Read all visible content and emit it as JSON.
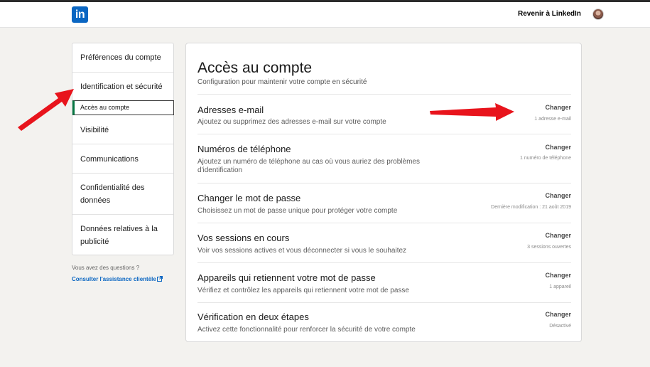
{
  "header": {
    "logo": "in",
    "back_link": "Revenir à LinkedIn"
  },
  "sidebar": {
    "items": [
      {
        "label": "Préférences du compte"
      },
      {
        "label": "Identification et sécurité"
      },
      {
        "label": "Accès au compte"
      },
      {
        "label": "Visibilité"
      },
      {
        "label": "Communications"
      },
      {
        "label": "Confidentialité des données"
      },
      {
        "label": "Données relatives à la publicité"
      }
    ],
    "help_question": "Vous avez des questions ?",
    "help_link": "Consulter l'assistance clientèle"
  },
  "main": {
    "title": "Accès au compte",
    "subtitle": "Configuration pour maintenir votre compte en sécurité",
    "rows": [
      {
        "title": "Adresses e-mail",
        "desc": "Ajoutez ou supprimez des adresses e-mail sur votre compte",
        "action": "Changer",
        "status": "1 adresse e-mail"
      },
      {
        "title": "Numéros de téléphone",
        "desc": "Ajoutez un numéro de téléphone au cas où vous auriez des problèmes d'identification",
        "action": "Changer",
        "status": "1 numéro de téléphone"
      },
      {
        "title": "Changer le mot de passe",
        "desc": "Choisissez un mot de passe unique pour protéger votre compte",
        "action": "Changer",
        "status": "Dernière modification : 21 août 2019"
      },
      {
        "title": "Vos sessions en cours",
        "desc": "Voir vos sessions actives et vous déconnecter si vous le souhaitez",
        "action": "Changer",
        "status": "3 sessions ouvertes"
      },
      {
        "title": "Appareils qui retiennent votre mot de passe",
        "desc": "Vérifiez et contrôlez les appareils qui retiennent votre mot de passe",
        "action": "Changer",
        "status": "1 appareil"
      },
      {
        "title": "Vérification en deux étapes",
        "desc": "Activez cette fonctionnalité pour renforcer la sécurité de votre compte",
        "action": "Changer",
        "status": "Désactivé"
      }
    ]
  },
  "colors": {
    "brand": "#0a66c2",
    "active_indicator": "#057642",
    "annotation_arrow": "#e8141c"
  }
}
